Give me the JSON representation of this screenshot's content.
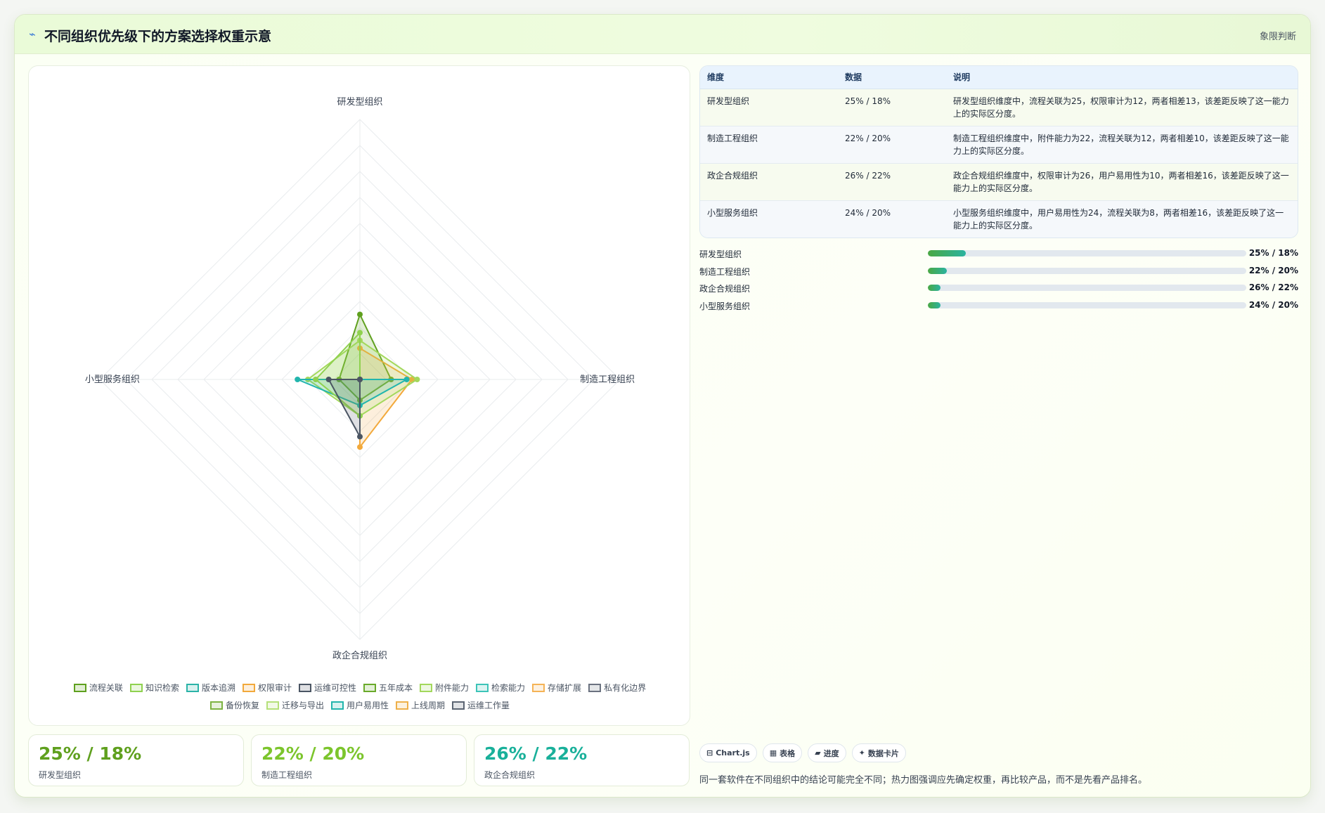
{
  "header": {
    "icon": "trend-icon",
    "title": "不同组织优先级下的方案选择权重示意",
    "badge": "象限判断"
  },
  "chart_data": {
    "type": "radar",
    "axes": [
      "研发型组织",
      "制造工程组织",
      "政企合规组织",
      "小型服务组织"
    ],
    "r_max": 100,
    "grid_levels": 10,
    "legend": [
      {
        "name": "流程关联",
        "color": "#5fa01e",
        "fill": "rgba(95,160,30,0.18)"
      },
      {
        "name": "知识检索",
        "color": "#8fd14f",
        "fill": "rgba(143,209,79,0.18)"
      },
      {
        "name": "版本追溯",
        "color": "#2bb3a8",
        "fill": "rgba(43,179,168,0.18)"
      },
      {
        "name": "权限审计",
        "color": "#f2a93b",
        "fill": "rgba(242,169,59,0.18)"
      },
      {
        "name": "运维可控性",
        "color": "#4b5563",
        "fill": "rgba(75,85,99,0.18)"
      },
      {
        "name": "五年成本",
        "color": "#6aaa2a",
        "fill": "rgba(106,170,42,0.18)"
      },
      {
        "name": "附件能力",
        "color": "#a3d85c",
        "fill": "rgba(163,216,92,0.18)"
      },
      {
        "name": "检索能力",
        "color": "#3cc4b8",
        "fill": "rgba(60,196,184,0.18)"
      },
      {
        "name": "存储扩展",
        "color": "#f5b356",
        "fill": "rgba(245,179,86,0.18)"
      },
      {
        "name": "私有化边界",
        "color": "#6b7280",
        "fill": "rgba(107,114,128,0.18)"
      },
      {
        "name": "备份恢复",
        "color": "#7cb342",
        "fill": "rgba(124,179,66,0.18)"
      },
      {
        "name": "迁移与导出",
        "color": "#b5e07a",
        "fill": "rgba(181,224,122,0.18)"
      },
      {
        "name": "用户易用性",
        "color": "#22b5ad",
        "fill": "rgba(34,181,173,0.18)"
      },
      {
        "name": "上线周期",
        "color": "#eeb04a",
        "fill": "rgba(238,176,74,0.18)"
      },
      {
        "name": "运维工作量",
        "color": "#5b6472",
        "fill": "rgba(91,100,114,0.18)"
      }
    ],
    "series": [
      {
        "name": "流程关联",
        "values": [
          25,
          12,
          8,
          8
        ]
      },
      {
        "name": "权限审计",
        "values": [
          12,
          20,
          26,
          0
        ]
      },
      {
        "name": "附件能力",
        "values": [
          15,
          22,
          14,
          20
        ]
      },
      {
        "name": "用户易用性",
        "values": [
          0,
          18,
          10,
          24
        ]
      },
      {
        "name": "知识检索",
        "values": [
          18,
          0,
          14,
          17
        ]
      },
      {
        "name": "运维可控性",
        "values": [
          0,
          0,
          22,
          12
        ]
      }
    ]
  },
  "kpis": [
    {
      "value": "25% / 18%",
      "label": "研发型组织",
      "color": "#5fa01e"
    },
    {
      "value": "22% / 20%",
      "label": "制造工程组织",
      "color": "#7cc52c"
    },
    {
      "value": "26% / 22%",
      "label": "政企合规组织",
      "color": "#19b09a"
    }
  ],
  "table": {
    "headers": [
      "维度",
      "数据",
      "说明"
    ],
    "rows": [
      {
        "dim": "研发型组织",
        "data": "25% / 18%",
        "desc": "研发型组织维度中，流程关联为25，权限审计为12，两者相差13，该差距反映了这一能力上的实际区分度。"
      },
      {
        "dim": "制造工程组织",
        "data": "22% / 20%",
        "desc": "制造工程组织维度中，附件能力为22，流程关联为12，两者相差10，该差距反映了这一能力上的实际区分度。"
      },
      {
        "dim": "政企合规组织",
        "data": "26% / 22%",
        "desc": "政企合规组织维度中，权限审计为26，用户易用性为10，两者相差16，该差距反映了这一能力上的实际区分度。"
      },
      {
        "dim": "小型服务组织",
        "data": "24% / 20%",
        "desc": "小型服务组织维度中，用户易用性为24，流程关联为8，两者相差16，该差距反映了这一能力上的实际区分度。"
      }
    ]
  },
  "progress": [
    {
      "label": "研发型组织",
      "value": "25% / 18%",
      "fraction": 0.12
    },
    {
      "label": "制造工程组织",
      "value": "22% / 20%",
      "fraction": 0.06
    },
    {
      "label": "政企合规组织",
      "value": "26% / 22%",
      "fraction": 0.04
    },
    {
      "label": "小型服务组织",
      "value": "24% / 20%",
      "fraction": 0.04
    }
  ],
  "chips": [
    {
      "icon": "chart-icon",
      "glyph": "⊟",
      "label": "Chart.js"
    },
    {
      "icon": "table-icon",
      "glyph": "▦",
      "label": "表格"
    },
    {
      "icon": "progress-icon",
      "glyph": "▰",
      "label": "进度"
    },
    {
      "icon": "card-icon",
      "glyph": "✦",
      "label": "数据卡片"
    }
  ],
  "note": "同一套软件在不同组织中的结论可能完全不同；热力图强调应先确定权重，再比较产品，而不是先看产品排名。"
}
